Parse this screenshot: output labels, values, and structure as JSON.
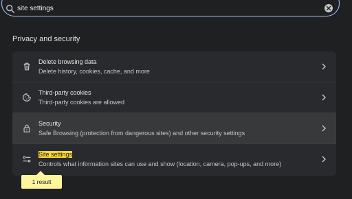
{
  "search": {
    "value": "site settings",
    "icon": "search-icon"
  },
  "section": {
    "title": "Privacy and security"
  },
  "items": [
    {
      "title": "Delete browsing data",
      "subtitle": "Delete history, cookies, cache, and more",
      "icon": "trash-icon"
    },
    {
      "title": "Third-party cookies",
      "subtitle": "Third-party cookies are allowed",
      "icon": "cookie-icon"
    },
    {
      "title": "Security",
      "subtitle": "Safe Browsing (protection from dangerous sites) and other security settings",
      "icon": "lock-icon"
    },
    {
      "title": "Site settings",
      "subtitle": "Controls what information sites can use and show (location, camera, pop-ups, and more)",
      "icon": "sliders-icon"
    }
  ],
  "tooltip": {
    "text": "1 result"
  },
  "colors": {
    "background": "#1f2022",
    "card": "#292a2d",
    "accent": "#a8c7fa",
    "highlight": "#fdd835",
    "tooltip": "#fff59d"
  }
}
